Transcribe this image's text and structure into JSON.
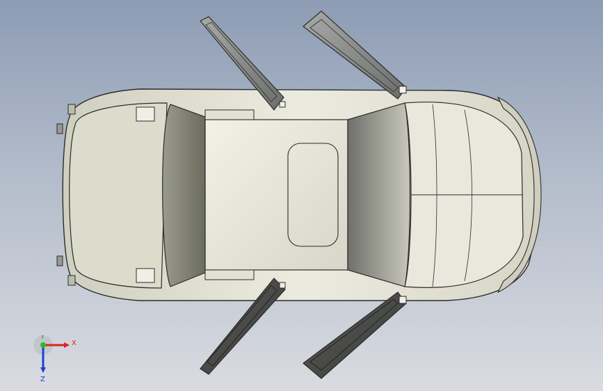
{
  "viewport": {
    "background_top": "#8d9cb4",
    "background_bottom": "#d9dbe0"
  },
  "model": {
    "body_color": "#e6e5d6",
    "glass_color": "#7e7f6f",
    "door_dark_color": "#4e4f4c",
    "door_light_color": "#8a8c88",
    "edge_color": "#2b2b2b",
    "doors_open": 4
  },
  "triad": {
    "x_label": "X",
    "y_label": "Y",
    "z_label": "Z",
    "x_color": "#e02020",
    "y_color": "#20c020",
    "z_color": "#2040d0"
  }
}
